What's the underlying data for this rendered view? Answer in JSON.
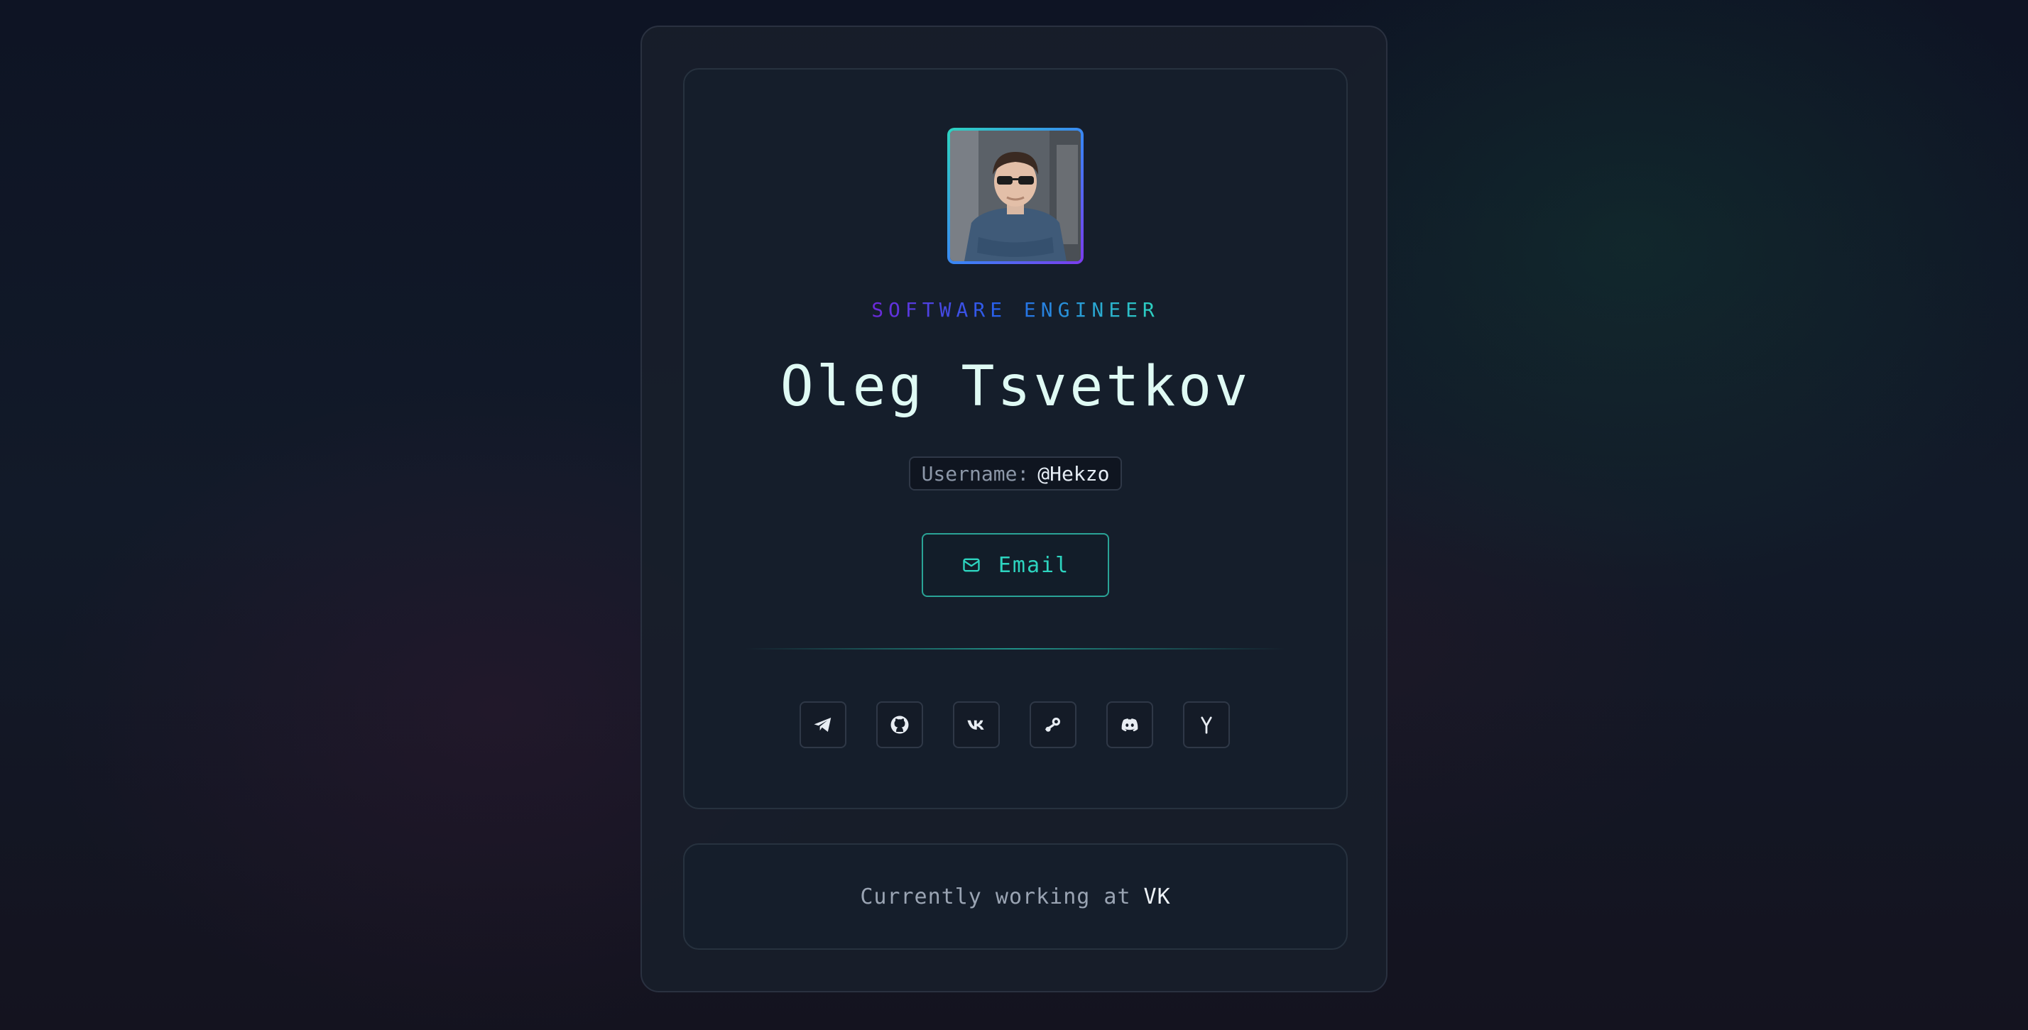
{
  "profile": {
    "role": "SOFTWARE ENGINEER",
    "name": "Oleg Tsvetkov",
    "username_label": "Username:",
    "username_value": "@Hekzo",
    "email_label": "Email"
  },
  "social_links": [
    {
      "icon": "telegram-icon"
    },
    {
      "icon": "github-icon"
    },
    {
      "icon": "vk-icon"
    },
    {
      "icon": "steam-icon"
    },
    {
      "icon": "discord-icon"
    },
    {
      "icon": "y-icon",
      "glyph": "Y"
    }
  ],
  "status": {
    "text": "Currently working at",
    "company": "VK"
  },
  "colors": {
    "accent": "#2dd4bf",
    "accent_purple": "#7c3aed",
    "name_text": "#dffaf4",
    "background": "#0e1424",
    "card": "#151e2b"
  }
}
